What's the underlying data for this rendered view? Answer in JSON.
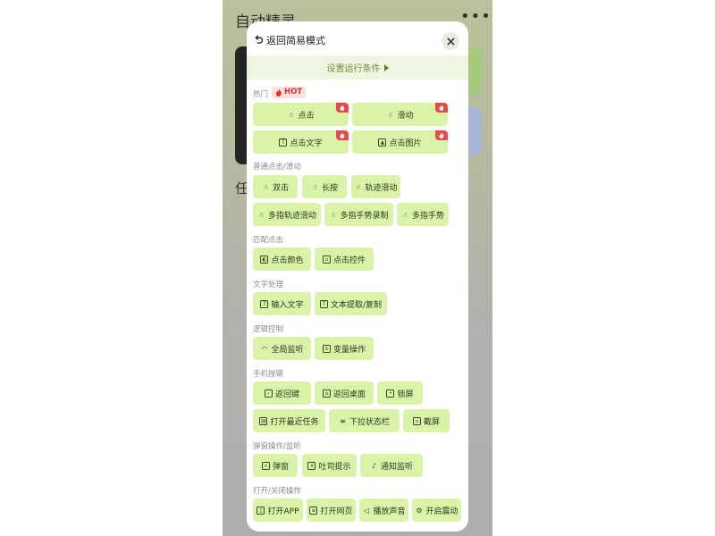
{
  "background": {
    "title": "自动精灵",
    "menu_glyph": "•••",
    "task_label": "任"
  },
  "modal": {
    "header_title": "返回简易模式",
    "condition_label": "设置运行条件",
    "sections": {
      "hot": "热门",
      "hot_badge": "HOT",
      "normal": "普通点击/滑动",
      "match": "匹配点击",
      "text": "文字处理",
      "logic": "逻辑控制",
      "phone": "手机按键",
      "popup": "弹窗操作/监听",
      "open": "打开/关闭操作"
    },
    "buttons": {
      "tap": "点击",
      "swipe": "滑动",
      "tap_text": "点击文字",
      "tap_image": "点击图片",
      "double_tap": "双击",
      "long_press": "长按",
      "track_swipe": "轨迹滑动",
      "multi_track": "多指轨迹滑动",
      "multi_record": "多指手势录制",
      "multi_gesture": "多指手势",
      "tap_color": "点击颜色",
      "tap_control": "点击控件",
      "input_text": "输入文字",
      "text_extract": "文本提取/复制",
      "global_listen": "全局监听",
      "variable_op": "变量操作",
      "back_key": "返回键",
      "home": "返回桌面",
      "lock": "锁屏",
      "recent_tasks": "打开最近任务",
      "status_bar": "下拉状态栏",
      "screenshot": "截屏",
      "popup": "弹窗",
      "toast": "吐司提示",
      "notify_listen": "通知监听",
      "open_app": "打开APP",
      "open_web": "打开网页",
      "play_sound": "播放声音",
      "vibrate": "开启震动"
    }
  },
  "colors": {
    "button_bg": "#d9f3a9",
    "condition_bg": "#eef6e2",
    "hot_red": "#e02c2c"
  }
}
